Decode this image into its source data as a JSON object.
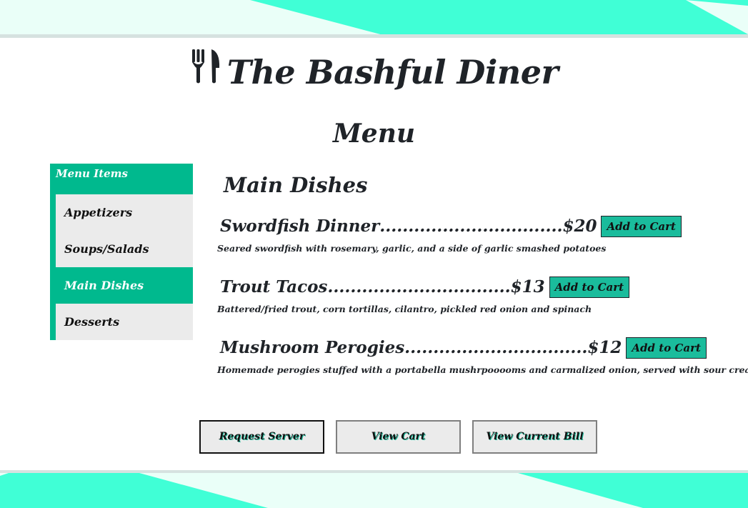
{
  "colors": {
    "accent": "#00b98e",
    "accent_light": "#40ffd6",
    "button_green": "#1abc9c",
    "text_dark": "#1f2328",
    "panel_gray": "#ebebeb"
  },
  "header": {
    "icon": "fork-knife-icon",
    "title": "The Bashful Diner",
    "menu_heading": "Menu"
  },
  "sidebar": {
    "title": "Menu Items",
    "items": [
      {
        "label": "Appetizers",
        "active": false
      },
      {
        "label": "Soups/Salads",
        "active": false
      },
      {
        "label": "Main Dishes",
        "active": true
      },
      {
        "label": "Desserts",
        "active": false
      }
    ]
  },
  "main": {
    "section_title": "Main Dishes",
    "dishes": [
      {
        "name": "Swordfish Dinner",
        "dots": "................................",
        "price": "$20",
        "button": "Add to Cart",
        "description": "Seared swordfish with rosemary, garlic, and a side of garlic smashed potatoes"
      },
      {
        "name": "Trout Tacos",
        "dots": "................................",
        "price": "$13",
        "button": "Add to Cart",
        "description": "Battered/fried trout, corn tortillas, cilantro, pickled red onion and spinach"
      },
      {
        "name": "Mushroom Perogies",
        "dots": "................................",
        "price": "$12",
        "button": "Add to Cart",
        "description": "Homemade perogies stuffed with a portabella mushrpooooms and carmalized onion, served with sour cream"
      }
    ]
  },
  "footer": {
    "request_server": "Request Server",
    "view_cart": "View Cart",
    "view_bill": "View Current Bill"
  }
}
